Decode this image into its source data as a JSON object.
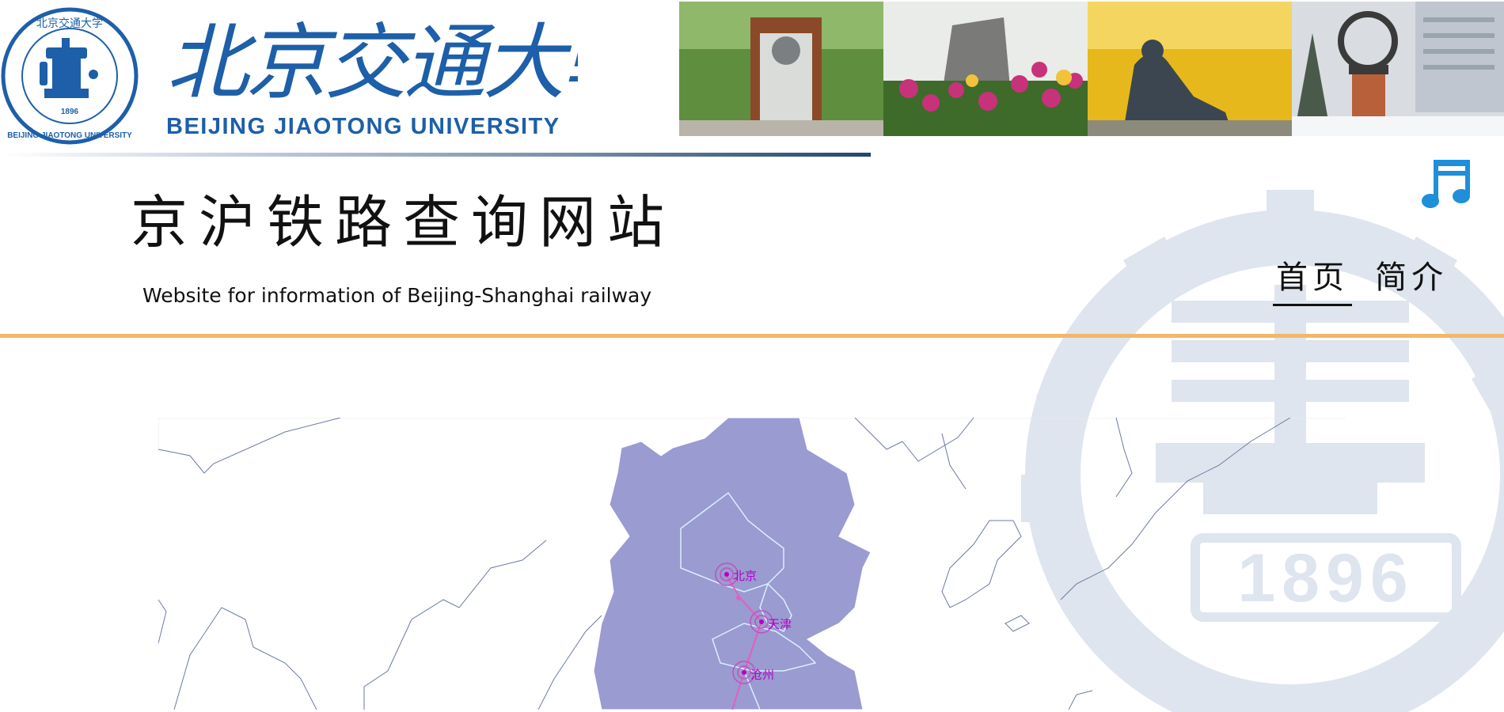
{
  "banner": {
    "logo_script_text": "北京交通大學",
    "logo_english": "BEIJING JIAOTONG UNIVERSITY",
    "seal_text_top": "北京交通大学",
    "seal_text_bottom": "BEIJING JIAOTONG UNIVERSITY",
    "seal_year": "1896"
  },
  "site": {
    "title": "京沪铁路查询网站",
    "subtitle": "Website for information of Beijing-Shanghai railway"
  },
  "nav": {
    "items": [
      {
        "label": "首页",
        "active": true
      },
      {
        "label": "简介",
        "active": false
      }
    ]
  },
  "watermark": {
    "year": "1896"
  },
  "map": {
    "cities": [
      {
        "name": "北京"
      },
      {
        "name": "天津"
      },
      {
        "name": "沧州"
      }
    ],
    "colors": {
      "region_fill": "#9a9bd0",
      "route": "#e060c0",
      "label": "#b400c8"
    }
  },
  "colors": {
    "brand_blue": "#1d5fa8",
    "accent_orange": "#f0b86a",
    "music_icon": "#1e8fd8"
  },
  "icons": [
    "music-note-icon"
  ]
}
